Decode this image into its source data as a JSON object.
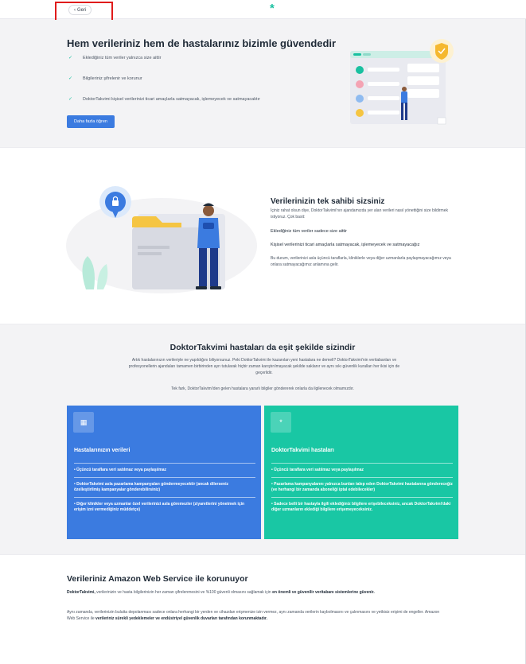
{
  "header": {
    "back_label": "Geri",
    "logo_glyph": "*",
    "brand_color": "#19c0a0"
  },
  "hero": {
    "title": "Hem verileriniz hem de hastalarınız bizimle güvendedir",
    "items": [
      "Eklediğiniz tüm veriler yalnızca size aittir",
      "Bilgileriniz şifrelenir ve korunur",
      "DoktorTakvimi kişisel verilerinizi ticari amaçlarla satmayacak, işlemeyecek ve satmayacaktır"
    ],
    "button_label": "Daha fazla öğren"
  },
  "ownership": {
    "title": "Verilerinizin tek sahibi sizsiniz",
    "intro": "İçiniz rahat olsun diye, DoktorTakvimi'nın ajandamızda yer alan verileri nasıl yönettiğini size bildirmek istiyoruz. Çok basit:",
    "point1": "Eklediğiniz tüm veriler sadece size aittir",
    "point2": "Kişisel verilerinizi ticari amaçlarla satmayacak, işlemeyecek ve satmayacağız",
    "point2_detail": "Bu durum, verilerinizi asla üçüncü taraflarla, kliniklerle veya diğer uzmanlarla paylaşmayacağımız veya onlara satmayacağımız anlamına gelir."
  },
  "equal": {
    "title": "DoktorTakvimi hastaları da eşit şekilde sizindir",
    "intro": "Artık hastalarınızın verileriyle ne yapıldığını biliyorsunuz. Peki DoktorTakvimi ile kazanılan yeni hastalara ne demeli? DoktorTakvimi'nin veritabanları ve profesyonellerin ajandaları tamamen birbirinden ayrı tutularak hiçbir zaman karıştırılmayacak şekilde saklanır ve aynı sıkı güvenlik kuralları her ikisi için de geçerlidir.",
    "note": "Tek fark, DoktorTakvimi'den gelen hastalara yararlı bilgiler göndererek onlarla da ilgilenecek olmamızdır.",
    "cards": [
      {
        "icon": "building-icon",
        "title": "Hastalarınızın verileri",
        "color": "#3b7be0",
        "items": [
          "• Üçüncü taraflara veri satılmaz veya paylaşılmaz",
          "• DoktorTakvimi asla pazarlama kampanyaları göndermeyecektir (ancak dilerseniz özelleştirilmiş kampanyalar gönderebilirsiniz)",
          "• Diğer klinikler veya uzmanlar özel verilerinizi asla göremezler (ziyaretlerini yönetmek için erişim izni vermediğiniz müddetçe)"
        ]
      },
      {
        "icon": "asterisk-icon",
        "title": "DoktorTakvimi hastaları",
        "color": "#19c7a4",
        "items": [
          "• Üçüncü taraflara veri satılmaz veya paylaşılmaz",
          "• Pazarlama kampanyalarını yalnızca bunları talep eden DoktorTakvimi hastalarına göndereceğiz (ve herhangi bir zamanda aboneliği iptal edebilecekler)",
          "• Sadece belli bir hastayla ilgili eklediğiniz bilgilere erişebileceksiniz, ancak DoktorTakvimi'daki diğer uzmanların eklediği bilgilere erişemeyeceksiniz."
        ]
      }
    ]
  },
  "aws": {
    "title": "Verileriniz Amazon Web Service ile korunuyor",
    "p1_bold_start": "DoktorTakvimi,",
    "p1_text": " verilerinizin ve hasta bilgilerinizin her zaman şifrelenmesini ve %100 güvenli olmasını sağlamak için ",
    "p1_bold_end": "en önemli ve güvenilir veritabanı sistemlerine güvenir.",
    "p2_text": "Aynı zamanda, verilerinizin bulutta depolanması sadece onlara herhangi bir yerden ve cihazdan erişmenize izin vermez, aynı zamanda verilerin kaybolmasını ve çalınmasını ve yetkisiz erişimi de engeller. Amazon Web Service ile ",
    "p2_bold": "verileriniz sürekli yedeklemeler ve endüstriyel güvenlik duvarları tarafından korunmaktadır."
  }
}
